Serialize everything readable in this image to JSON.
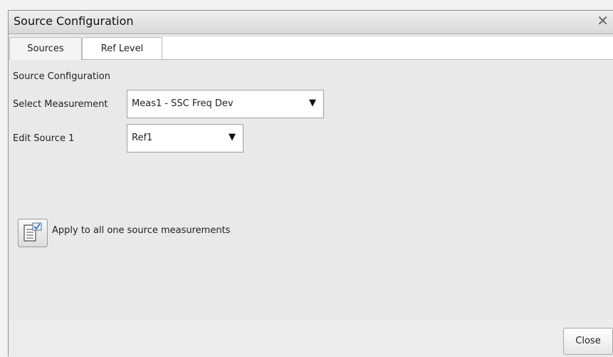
{
  "dialog": {
    "title": "Source Configuration",
    "close_icon": "close-icon"
  },
  "tabs": [
    {
      "label": "Sources",
      "selected": true
    },
    {
      "label": "Ref Level",
      "selected": false
    }
  ],
  "panel": {
    "section_title": "Source Configuration",
    "select_measurement": {
      "label": "Select Measurement",
      "value": "Meas1 - SSC Freq Dev"
    },
    "edit_source": {
      "label": "Edit Source 1",
      "value": "Ref1"
    },
    "apply_all": {
      "icon": "apply-to-all-icon",
      "label": "Apply to all one source measurements"
    }
  },
  "footer": {
    "close_label": "Close"
  }
}
